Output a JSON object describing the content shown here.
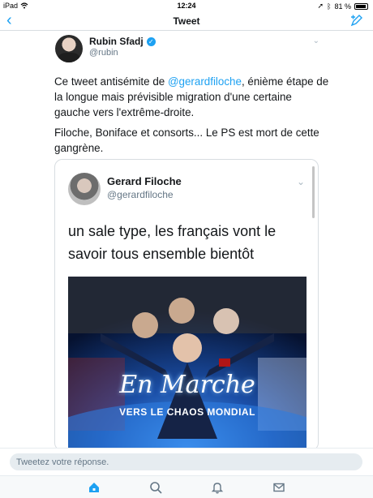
{
  "status_bar": {
    "device": "iPad",
    "time": "12:24",
    "battery": "81 %"
  },
  "nav": {
    "back_icon": "chevron-left-icon",
    "title": "Tweet",
    "compose_icon": "compose-icon"
  },
  "tweet": {
    "author_name": "Rubin Sfadj",
    "author_handle": "@rubin",
    "text_part1": "Ce tweet antisémite de ",
    "mention": "@gerardfiloche",
    "text_part2": ", énième étape de la longue mais prévisible migration d'une certaine gauche vers l'extrême-droite.",
    "text_para2": "Filoche, Boniface et consorts... Le PS est mort de cette gangrène."
  },
  "quoted_tweet": {
    "author_name": "Gerard Filoche",
    "author_handle": "@gerardfiloche",
    "text": "un sale type, les français vont le savoir tous ensemble bientôt",
    "media_title": "En Marche",
    "media_subtitle": "VERS LE CHAOS MONDIAL"
  },
  "reply": {
    "placeholder": "Tweetez votre réponse."
  },
  "tabs": [
    {
      "icon": "home-icon",
      "active": true
    },
    {
      "icon": "search-icon",
      "active": false
    },
    {
      "icon": "notifications-icon",
      "active": false
    },
    {
      "icon": "messages-icon",
      "active": false
    }
  ],
  "colors": {
    "accent": "#1da1f2",
    "text": "#14171a",
    "secondary": "#657786"
  }
}
